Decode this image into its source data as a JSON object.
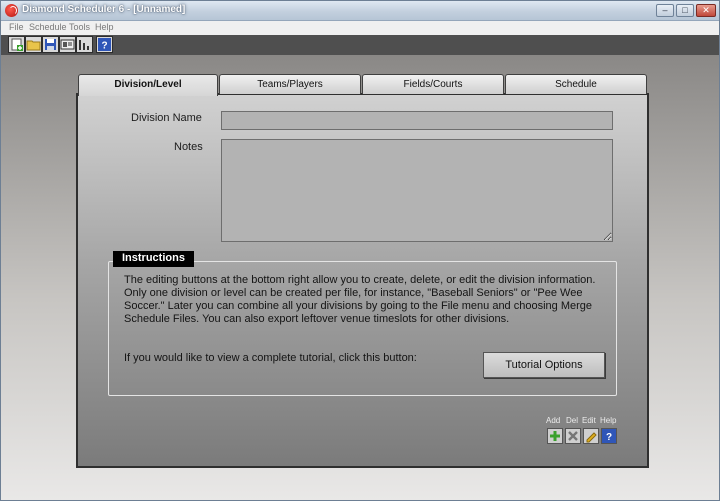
{
  "window": {
    "title": "Diamond Scheduler 6 - [Unnamed]",
    "min_symbol": "–",
    "max_symbol": "□",
    "close_symbol": "✕"
  },
  "menu": [
    "File",
    "Schedule",
    "Tools",
    "Help"
  ],
  "toolbar": {
    "icons": [
      "new-file-icon",
      "open-folder-icon",
      "save-icon",
      "print-preview-icon",
      "chart-icon",
      "help-icon"
    ]
  },
  "tabs": [
    {
      "label": "Division/Level",
      "active": true
    },
    {
      "label": "Teams/Players",
      "active": false
    },
    {
      "label": "Fields/Courts",
      "active": false
    },
    {
      "label": "Schedule",
      "active": false
    }
  ],
  "form": {
    "division_label": "Division Name",
    "division_value": "",
    "notes_label": "Notes",
    "notes_value": ""
  },
  "instructions": {
    "title": "Instructions",
    "text": "The editing buttons at the bottom right allow you to create, delete, or edit the division information. Only one division or level can be created per file, for instance, \"Baseball Seniors\" or \"Pee Wee Soccer.\"  Later you can combine all your divisions by going to the File menu and choosing Merge Schedule Files. You can also export leftover venue timeslots for other divisions.",
    "tutorial_prompt": "If you would like to view a complete tutorial, click this button:",
    "tutorial_button": "Tutorial Options"
  },
  "edit_buttons": {
    "add": "Add",
    "delete": "Del",
    "edit": "Edit",
    "help": "Help"
  },
  "colors": {
    "add_green": "#3aa02c",
    "delete_gray": "#777777",
    "edit_yellow": "#e0b020",
    "help_blue": "#2f56b8"
  }
}
